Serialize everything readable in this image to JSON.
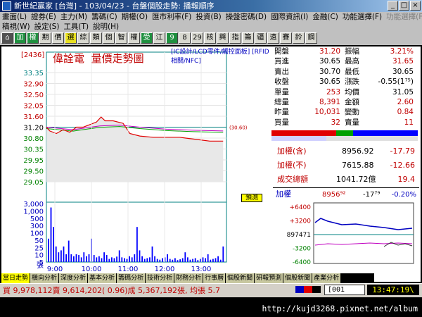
{
  "window": {
    "title": "新世紀贏家 [台灣] - 103/04/23 - 台盤個股走勢: 播報順序",
    "minimize": "_",
    "maximize": "□",
    "close": "×"
  },
  "menu_row1": [
    "畫面(L)",
    "證券(E)",
    "主力(M)",
    "籌碼(C)",
    "期權(O)",
    "匯市利率(F)",
    "投資(B)",
    "操盤密碼(D)",
    "國際資訊(I)",
    "金融(C)",
    "功能選擇(F)",
    "功能選擇(F)"
  ],
  "menu_row2": [
    "稿視(W)",
    "設定(S)",
    "工具(T)",
    "說明(H)"
  ],
  "toolbar": [
    "加",
    "權",
    "期",
    "價",
    "選",
    "綜",
    "類",
    "個",
    "智",
    "權",
    "受",
    "江",
    "9",
    "8",
    "29",
    "核",
    "興",
    "指",
    "籌",
    "疆",
    "遠",
    "賽",
    "鈴",
    "鋼"
  ],
  "stock": {
    "code": "[2436]",
    "name": "偉詮電",
    "chart_title": "量價走勢圖",
    "sector_tags": "[IC設計/LCD零件/觸控面板] [RFID相關/NFC]",
    "price_marker_label": "(30.60)"
  },
  "chart_data": {
    "type": "line",
    "title": "量價走勢圖",
    "y_ticks": [
      "33.35",
      "32.90",
      "32.50",
      "32.05",
      "31.60",
      "31.20",
      "30.80",
      "30.35",
      "29.95",
      "29.50",
      "29.05"
    ],
    "volume_ticks": [
      "3,000",
      "1,000",
      "500",
      "300",
      "100",
      "50",
      "25",
      "10",
      "5"
    ],
    "volume_unit": "張",
    "x_ticks": [
      "9:00",
      "10:00",
      "11:00",
      "12:00",
      "13:00"
    ],
    "ylim": [
      29.05,
      33.35
    ],
    "reference_price": 31.2,
    "price_series": [
      {
        "t": 0,
        "v": 31.2
      },
      {
        "t": 5,
        "v": 31.05
      },
      {
        "t": 15,
        "v": 30.95
      },
      {
        "t": 25,
        "v": 31.1
      },
      {
        "t": 35,
        "v": 31.0
      },
      {
        "t": 45,
        "v": 31.2
      },
      {
        "t": 55,
        "v": 31.2
      },
      {
        "t": 65,
        "v": 31.3
      },
      {
        "t": 75,
        "v": 31.4
      },
      {
        "t": 82,
        "v": 31.6
      },
      {
        "t": 88,
        "v": 31.45
      },
      {
        "t": 100,
        "v": 31.45
      },
      {
        "t": 115,
        "v": 31.35
      },
      {
        "t": 125,
        "v": 30.95
      },
      {
        "t": 140,
        "v": 30.85
      },
      {
        "t": 160,
        "v": 30.8
      },
      {
        "t": 180,
        "v": 30.8
      },
      {
        "t": 200,
        "v": 30.8
      },
      {
        "t": 215,
        "v": 30.75
      },
      {
        "t": 230,
        "v": 30.7
      },
      {
        "t": 245,
        "v": 30.65
      },
      {
        "t": 265,
        "v": 30.65
      }
    ],
    "avg_series": [
      {
        "t": 0,
        "v": 31.2
      },
      {
        "t": 40,
        "v": 31.1
      },
      {
        "t": 80,
        "v": 31.25
      },
      {
        "t": 110,
        "v": 31.28
      },
      {
        "t": 140,
        "v": 31.2
      },
      {
        "t": 180,
        "v": 31.12
      },
      {
        "t": 220,
        "v": 31.08
      },
      {
        "t": 265,
        "v": 31.05
      }
    ],
    "volume_bars": [
      60,
      140,
      90,
      40,
      25,
      30,
      40,
      20,
      55,
      20,
      15,
      20,
      18,
      12,
      25,
      15,
      20,
      60,
      18,
      12,
      15,
      10,
      25,
      18,
      8,
      12,
      10,
      14,
      30,
      12,
      10,
      8,
      15,
      12,
      20,
      90,
      30,
      15,
      8,
      10,
      12,
      40,
      15,
      8,
      6,
      10,
      12,
      20,
      8,
      6,
      10,
      5,
      7,
      10,
      25,
      12,
      6,
      8,
      10,
      5,
      8,
      12,
      10,
      20,
      6,
      8,
      10,
      15,
      6,
      40
    ]
  },
  "quote": {
    "rows": [
      {
        "l1": "開盤",
        "v1": "31.20",
        "c1": "red",
        "l2": "振幅",
        "v2": "3.21%",
        "c2": "red"
      },
      {
        "l1": "買進",
        "v1": "30.65",
        "c1": "blk",
        "l2": "最高",
        "v2": "31.65",
        "c2": "red"
      },
      {
        "l1": "賣出",
        "v1": "30.70",
        "c1": "blk",
        "l2": "最低",
        "v2": "30.65",
        "c2": "blk"
      },
      {
        "l1": "收盤",
        "v1": "30.65",
        "c1": "blk",
        "l2": "漲跌",
        "v2": "-0.55(1⁷⁵)",
        "c2": "blk"
      },
      {
        "l1": "單量",
        "v1": "253",
        "c1": "red",
        "l2": "均價",
        "v2": "31.05",
        "c2": "blk"
      },
      {
        "l1": "總量",
        "v1": "8,391",
        "c1": "red",
        "l2": "金額",
        "v2": "2.60",
        "c2": "red"
      },
      {
        "l1": "昨量",
        "v1": "10,031",
        "c1": "red",
        "l2": "變動",
        "v2": "0.84",
        "c2": "red"
      },
      {
        "l1": "買量",
        "v1": "32",
        "c1": "red",
        "l2": "賣量",
        "v2": "11",
        "c2": "red"
      }
    ]
  },
  "index": {
    "rows": [
      {
        "label": "加權(含)",
        "value": "8956.92",
        "change": "-17.79"
      },
      {
        "label": "加權(不)",
        "value": "7615.88",
        "change": "-12.66"
      },
      {
        "label": "成交總額",
        "value": "1041.72億",
        "change": "19.4"
      }
    ],
    "mini": {
      "label": "加權",
      "value": "8956⁹²",
      "change": "-17⁷⁹",
      "pct": "-0.20%",
      "ticks": [
        "+6400",
        "+3200",
        "897471",
        "-3200",
        "-6400"
      ]
    }
  },
  "tabs": [
    "當日走勢",
    "橫向分析",
    "深度分析",
    "基本分析",
    "籌碼分析",
    "技術分析",
    "財務分析",
    "行事曆",
    "個股新聞",
    "研報預測",
    "個股新聞",
    "產業分析"
  ],
  "status": {
    "ticker": "買 9,978,112賣 9,614,202( 0.96)成 5,367,192張, 均張 5.7",
    "stock_box": "[001",
    "clock": "13:47:19\\",
    "predict": "預測"
  },
  "watermark": "http://kujd3268.pixnet.net/album",
  "colors": {
    "price_line": "#e00000",
    "avg_line": "#c000c0",
    "ref_line": "#008080",
    "volume_bar": "#0000ff",
    "grid": "#008080"
  }
}
